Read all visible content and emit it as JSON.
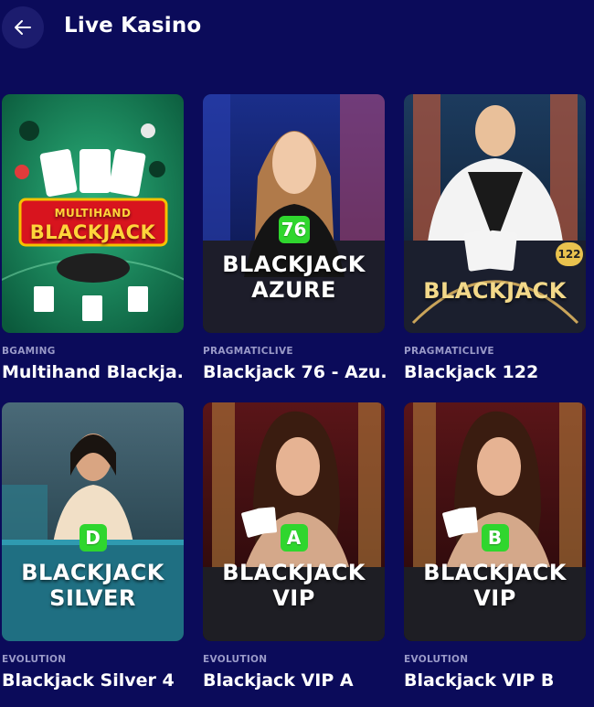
{
  "header": {
    "title": "Live Kasino"
  },
  "colors": {
    "background": "#0b0b5a",
    "badge": "#2fd62e",
    "provider_text": "#9a9ac8"
  },
  "games": [
    {
      "provider": "BGAMING",
      "name": "Multihand Blackja...",
      "thumb_title": [
        "MULTIHAND",
        "BLACKJACK"
      ]
    },
    {
      "provider": "PRAGMATICLIVE",
      "name": "Blackjack 76 - Azu...",
      "badge": "76",
      "thumb_title": [
        "BLACKJACK",
        "AZURE"
      ]
    },
    {
      "provider": "PRAGMATICLIVE",
      "name": "Blackjack 122",
      "badge": "122",
      "thumb_title": [
        "BLACKJACK"
      ]
    },
    {
      "provider": "EVOLUTION",
      "name": "Blackjack Silver 4",
      "badge": "D",
      "thumb_title": [
        "BLACKJACK",
        "SILVER"
      ]
    },
    {
      "provider": "EVOLUTION",
      "name": "Blackjack VIP A",
      "badge": "A",
      "thumb_title": [
        "BLACKJACK",
        "VIP"
      ]
    },
    {
      "provider": "EVOLUTION",
      "name": "Blackjack VIP B",
      "badge": "B",
      "thumb_title": [
        "BLACKJACK",
        "VIP"
      ]
    }
  ]
}
